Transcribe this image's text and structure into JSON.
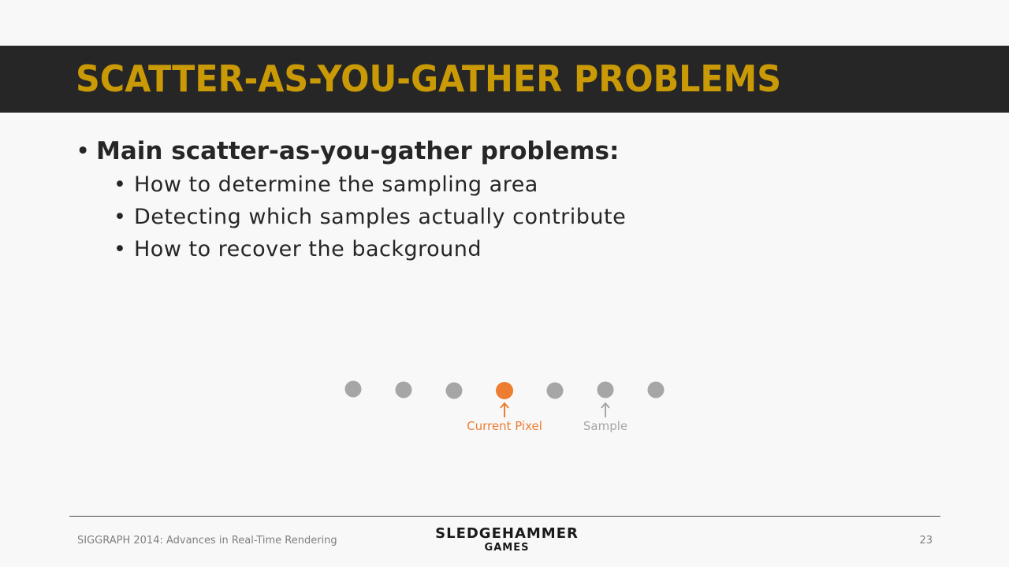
{
  "slide": {
    "title": "SCATTER-AS-YOU-GATHER PROBLEMS",
    "bullet_main": "Main scatter-as-you-gather problems:",
    "sub_bullets": [
      "How to determine the sampling area",
      "Detecting which samples actually contribute",
      "How to recover the background"
    ],
    "bullet_glyph": "•"
  },
  "diagram": {
    "current_pixel_label": "Current Pixel",
    "sample_label": "Sample",
    "dot_count": 7,
    "current_index": 3,
    "sample_arrow_index": 5,
    "colors": {
      "current": "#ED7D31",
      "sample": "#A6A6A6"
    }
  },
  "footer": {
    "conference": "SIGGRAPH 2014: Advances in Real-Time Rendering",
    "page_number": "23",
    "logo_line1": "SLEDGEHAMMER",
    "logo_line2": "GAMES"
  },
  "colors": {
    "title_bar": "#262626",
    "title_text": "#C99A06",
    "background": "#F8F8F8",
    "body_text": "#262626"
  }
}
